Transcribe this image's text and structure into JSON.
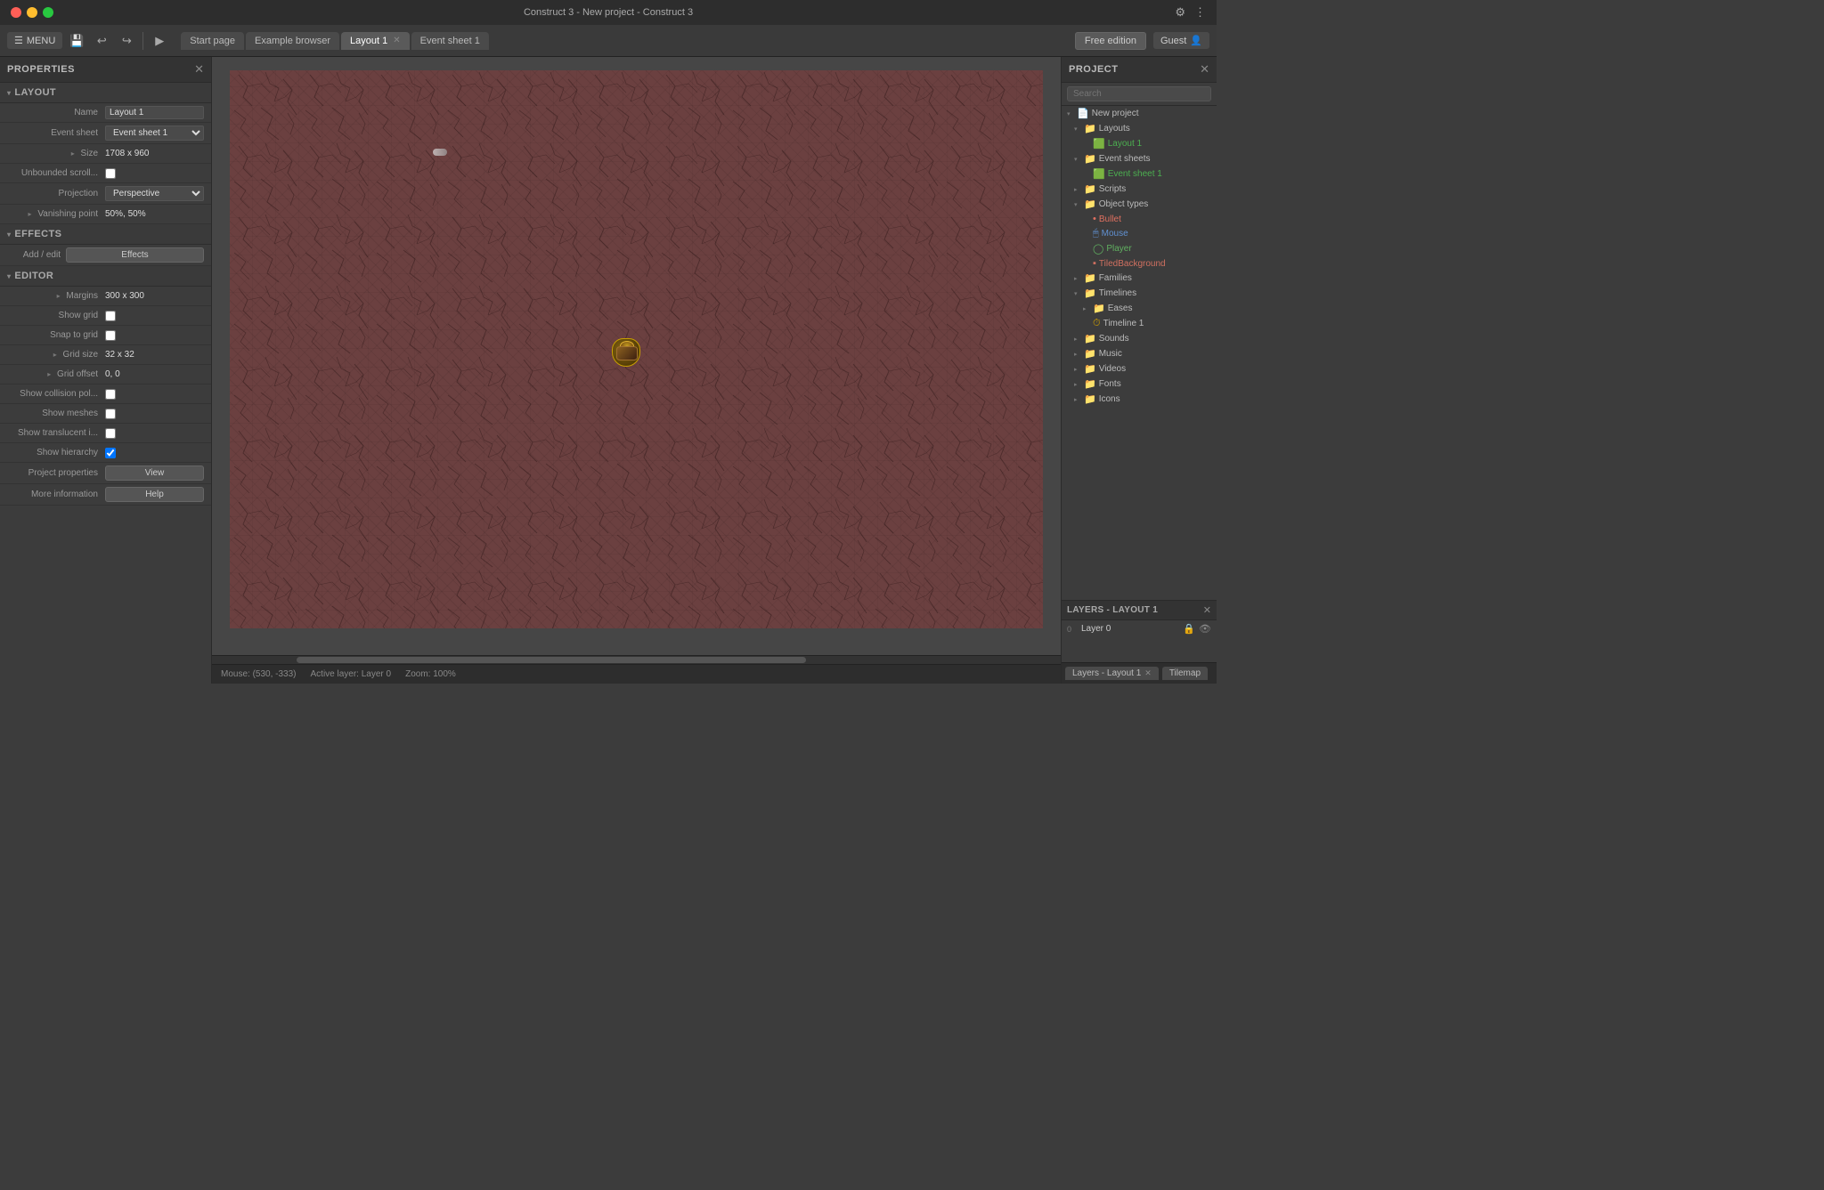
{
  "titlebar": {
    "title": "Construct 3 - New project - Construct 3",
    "btn_close": "●",
    "btn_min": "●",
    "btn_max": "●"
  },
  "toolbar": {
    "menu_label": "MENU",
    "tab_start": "Start page",
    "tab_browser": "Example browser",
    "tab_layout": "Layout 1",
    "tab_event": "Event sheet 1",
    "free_edition": "Free edition",
    "guest": "Guest"
  },
  "properties": {
    "panel_title": "PROPERTIES",
    "layout_section": "LAYOUT",
    "name_label": "Name",
    "name_value": "Layout 1",
    "event_sheet_label": "Event sheet",
    "event_sheet_value": "Event sheet 1",
    "size_label": "Size",
    "size_value": "1708 x 960",
    "unbounded_label": "Unbounded scroll...",
    "projection_label": "Projection",
    "projection_value": "Perspective",
    "vanishing_label": "Vanishing point",
    "vanishing_value": "50%, 50%",
    "effects_section": "EFFECTS",
    "add_edit_label": "Add / edit",
    "effects_btn": "Effects",
    "editor_section": "EDITOR",
    "margins_label": "Margins",
    "margins_value": "300 x 300",
    "show_grid_label": "Show grid",
    "snap_to_grid_label": "Snap to grid",
    "grid_size_label": "Grid size",
    "grid_size_value": "32 x 32",
    "grid_offset_label": "Grid offset",
    "grid_offset_value": "0, 0",
    "show_collision_label": "Show collision pol...",
    "show_meshes_label": "Show meshes",
    "show_translucent_label": "Show translucent i...",
    "show_hierarchy_label": "Show hierarchy",
    "project_props_label": "Project properties",
    "project_props_btn": "View",
    "more_info_label": "More information",
    "more_info_btn": "Help"
  },
  "project": {
    "panel_title": "PROJECT",
    "search_placeholder": "Search",
    "new_project": "New project",
    "layouts_folder": "Layouts",
    "layout1": "Layout 1",
    "event_sheets_folder": "Event sheets",
    "event_sheet1": "Event sheet 1",
    "scripts_folder": "Scripts",
    "object_types_folder": "Object types",
    "bullet": "Bullet",
    "mouse": "Mouse",
    "player": "Player",
    "tiled_bg": "TiledBackground",
    "families_folder": "Families",
    "timelines_folder": "Timelines",
    "eases_folder": "Eases",
    "timeline1": "Timeline 1",
    "sounds_folder": "Sounds",
    "music_folder": "Music",
    "videos_folder": "Videos",
    "fonts_folder": "Fonts",
    "icons_folder": "Icons"
  },
  "layers": {
    "title": "LAYERS - LAYOUT 1",
    "layer0_num": "0",
    "layer0_name": "Layer 0"
  },
  "status": {
    "mouse_pos": "Mouse: (530, -333)",
    "active_layer": "Active layer: Layer 0",
    "zoom": "Zoom: 100%"
  },
  "bottom_tabs": {
    "layers_tab": "Layers - Layout 1",
    "tilemap_tab": "Tilemap"
  },
  "icons": {
    "folder": "📁",
    "layout_icon": "🟩",
    "event_icon": "🟩",
    "bullet_icon": "🔴",
    "mouse_icon": "🖱",
    "player_icon": "🟢",
    "tiled_icon": "🟥",
    "arrow_down": "▾",
    "arrow_right": "▸",
    "lock": "🔒",
    "eye": "👁"
  }
}
